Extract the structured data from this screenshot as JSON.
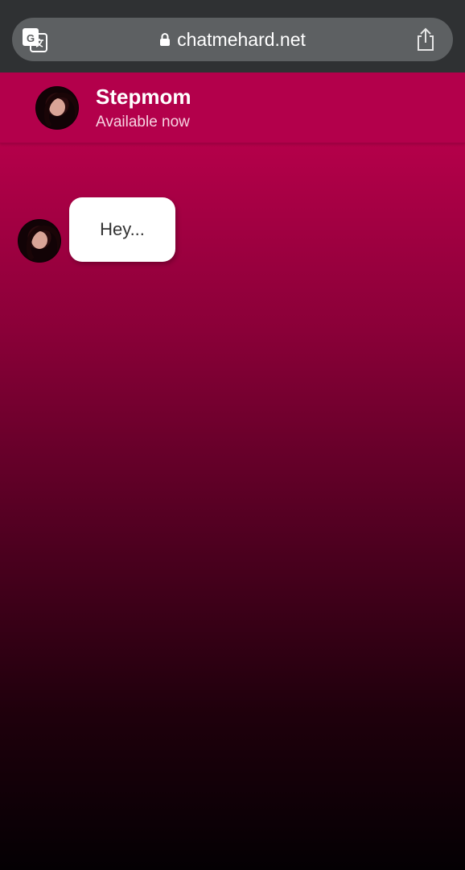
{
  "browser": {
    "url": "chatmehard.net",
    "translate_icon": "translate-icon",
    "lock_icon": "lock-icon",
    "share_icon": "share-icon"
  },
  "chat": {
    "contact_name": "Stepmom",
    "status": "Available now",
    "messages": [
      {
        "sender": "Stepmom",
        "text": "Hey..."
      }
    ]
  },
  "colors": {
    "header_bg": "#b3004b",
    "gradient_top": "#b5004a",
    "gradient_bottom": "#040003",
    "browser_bar": "#2f3133",
    "url_pill": "#5d6062"
  }
}
